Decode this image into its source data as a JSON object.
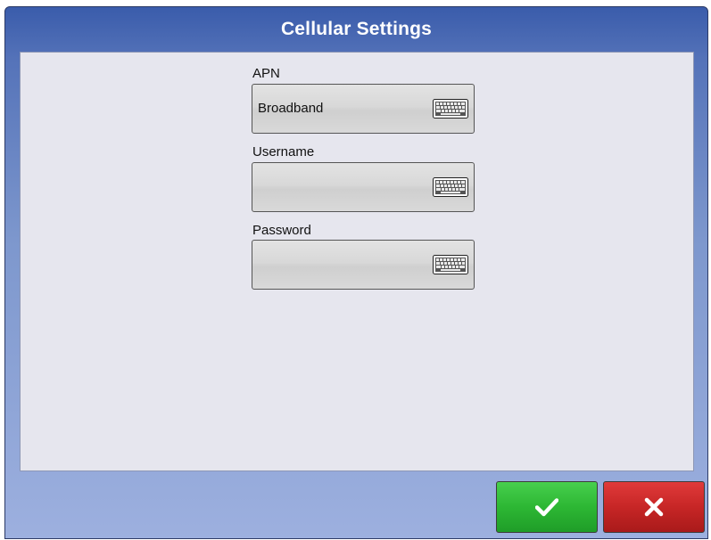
{
  "dialog": {
    "title": "Cellular Settings"
  },
  "fields": {
    "apn": {
      "label": "APN",
      "value": "Broadband",
      "icon": "keyboard-icon"
    },
    "username": {
      "label": "Username",
      "value": "",
      "icon": "keyboard-icon"
    },
    "password": {
      "label": "Password",
      "value": "",
      "icon": "keyboard-icon"
    }
  },
  "buttons": {
    "ok": {
      "icon": "checkmark-icon",
      "color": "#2db734"
    },
    "cancel": {
      "icon": "x-icon",
      "color": "#c72626"
    }
  },
  "colors": {
    "title_bar": "#3a5cab",
    "content_bg": "#e6e6ee"
  }
}
